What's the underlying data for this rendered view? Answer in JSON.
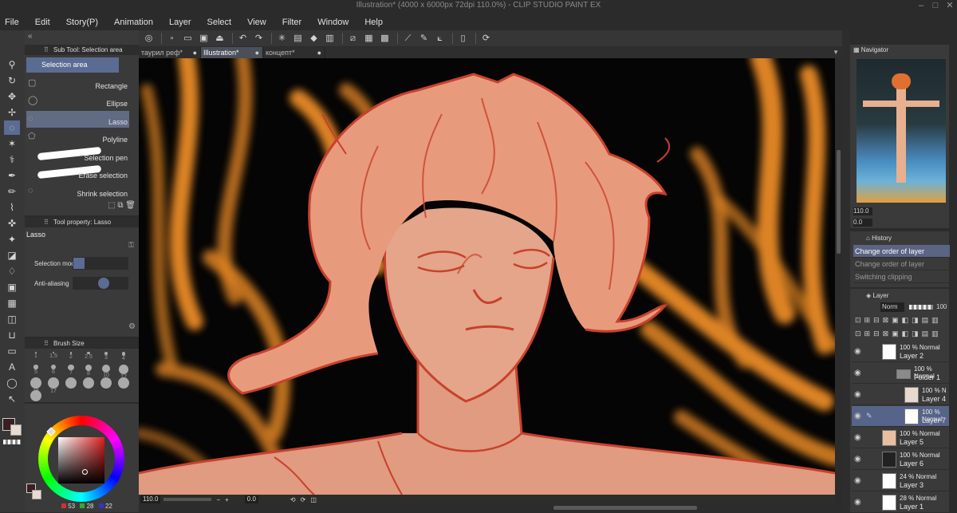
{
  "title": "Illustration* (4000 x 6000px 72dpi 110.0%)  - CLIP STUDIO PAINT EX",
  "window_controls": [
    "–",
    "□",
    "✕"
  ],
  "menu": [
    "File",
    "Edit",
    "Story(P)",
    "Animation",
    "Layer",
    "Select",
    "View",
    "Filter",
    "Window",
    "Help"
  ],
  "tabs": [
    {
      "label": "таурил реф*",
      "dot": "●"
    },
    {
      "label": "Illustration*",
      "dot": "●"
    },
    {
      "label": "концепт*",
      "dot": "●"
    }
  ],
  "subtool": {
    "header": "Sub Tool: Selection area",
    "group": "Selection area",
    "items": [
      "Rectangle",
      "Ellipse",
      "Lasso",
      "Polyline",
      "Selection pen",
      "Erase selection",
      "Shrink selection"
    ]
  },
  "toolprop": {
    "header": "Tool property: Lasso",
    "tool": "Lasso",
    "selection_mode": "Selection mode",
    "anti_aliasing": "Anti-aliasing"
  },
  "brushsize": {
    "header": "Brush Size",
    "sizes": [
      "1",
      "1.5",
      "2",
      "2.5",
      "3",
      "4",
      "5",
      "6",
      "7",
      "8",
      "10",
      "12",
      "15",
      "17",
      "",
      "",
      "",
      "",
      ""
    ]
  },
  "color": {
    "main": "#3a1e22",
    "sub": "#e8dcd0",
    "r": "53",
    "g": "28",
    "b": "22"
  },
  "status": {
    "zoom": "110.0",
    "angle": "0.0"
  },
  "navigator": {
    "header": "Navigator",
    "zoom": "110.0",
    "angle": "0.0"
  },
  "history": {
    "header": "History",
    "items": [
      "Change order of layer",
      "Change order of layer",
      "Switching clipping"
    ]
  },
  "layer_panel": {
    "header": "Layer",
    "blend": "Norm",
    "opacity": "100"
  },
  "layers": [
    {
      "opacity": "100 %",
      "mode": "Normal",
      "name": "Layer 2"
    },
    {
      "opacity": "100 %",
      "mode": "Normal",
      "name": "Folder 1"
    },
    {
      "opacity": "100 %",
      "mode": "N",
      "name": "Layer 4"
    },
    {
      "opacity": "100 %",
      "mode": "Normal",
      "name": "Layer 7"
    },
    {
      "opacity": "100 %",
      "mode": "Normal",
      "name": "Layer 5"
    },
    {
      "opacity": "100 %",
      "mode": "Normal",
      "name": "Layer 6"
    },
    {
      "opacity": "24 %",
      "mode": "Normal",
      "name": "Layer 3"
    },
    {
      "opacity": "28 %",
      "mode": "Normal",
      "name": "Layer 1"
    }
  ],
  "accent": "#5b6c93",
  "canvas_colors": {
    "bg": "#050505",
    "skin": "#e09b80",
    "line": "#c8412c",
    "hair": "#e89b7c",
    "glow": "#e88a25"
  }
}
